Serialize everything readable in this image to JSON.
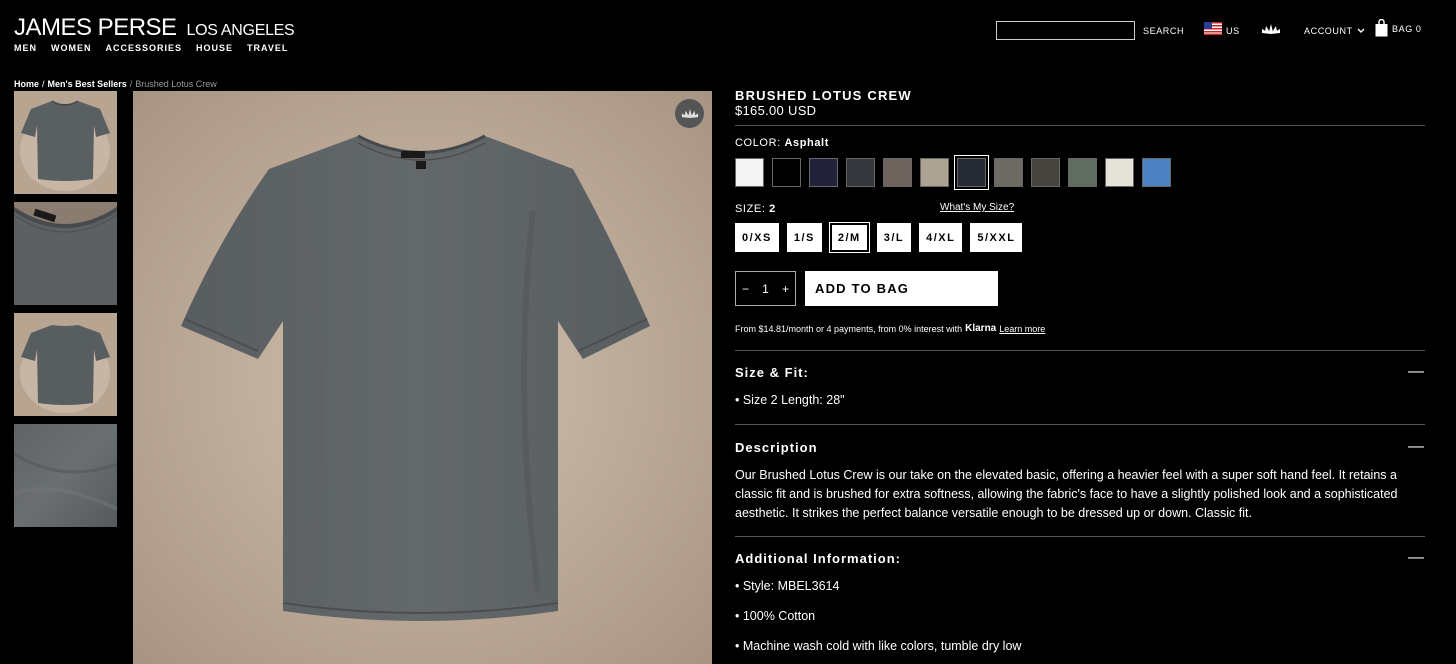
{
  "header": {
    "brand": "JAMES PERSE",
    "brand_sub": "LOS ANGELES",
    "nav": [
      "MEN",
      "WOMEN",
      "ACCESSORIES",
      "HOUSE",
      "TRAVEL"
    ],
    "search_label": "SEARCH",
    "country": "US",
    "account": "ACCOUNT",
    "bag": "BAG 0"
  },
  "breadcrumb": {
    "home": "Home",
    "category": "Men's Best Sellers",
    "current": "Brushed Lotus Crew",
    "sep": "/"
  },
  "product": {
    "title": "BRUSHED LOTUS CREW",
    "price": "$165.00 USD",
    "color_label": "COLOR:",
    "color_value": "Asphalt",
    "colors": [
      "#f4f4f4",
      "#000000",
      "#22233a",
      "#35363b",
      "#6f645d",
      "#aca393",
      "#262a33",
      "#6c6a63",
      "#45443f",
      "#5f6c5f",
      "#e4e1d9",
      "#4c82c2"
    ],
    "selected_color_index": 6,
    "size_label": "SIZE:",
    "size_value": "2",
    "whats_my_size": "What's My Size?",
    "sizes": [
      "0/XS",
      "1/S",
      "2/M",
      "3/L",
      "4/XL",
      "5/XXL"
    ],
    "selected_size_index": 2,
    "quantity": "1",
    "qty_minus": "−",
    "qty_plus": "+",
    "add_to_bag": "ADD TO BAG",
    "klarna": {
      "text": "From $14.81/month or 4 payments, from 0% interest with",
      "logo": "Klarna",
      "link": "Learn more"
    }
  },
  "sections": {
    "size_fit": {
      "title": "Size & Fit:",
      "toggle": "—",
      "items": [
        "• Size 2 Length: 28\""
      ]
    },
    "description": {
      "title": "Description",
      "toggle": "—",
      "text": "Our Brushed Lotus Crew is our take on the elevated basic, offering a heavier feel with a super soft hand feel. It retains a classic fit and is brushed for extra softness, allowing the fabric's face to have a slightly polished look and a sophisticated aesthetic. It strikes the perfect balance versatile enough to be dressed up or down. Classic fit."
    },
    "additional": {
      "title": "Additional Information:",
      "toggle": "—",
      "items": [
        "• Style: MBEL3614",
        "• 100% Cotton",
        "• Machine wash cold with like colors, tumble dry low"
      ]
    }
  },
  "icons": {
    "flag": "us-flag-icon",
    "lotus": "lotus-icon",
    "bag": "shopping-bag-icon",
    "chevron": "chevron-down-icon"
  }
}
